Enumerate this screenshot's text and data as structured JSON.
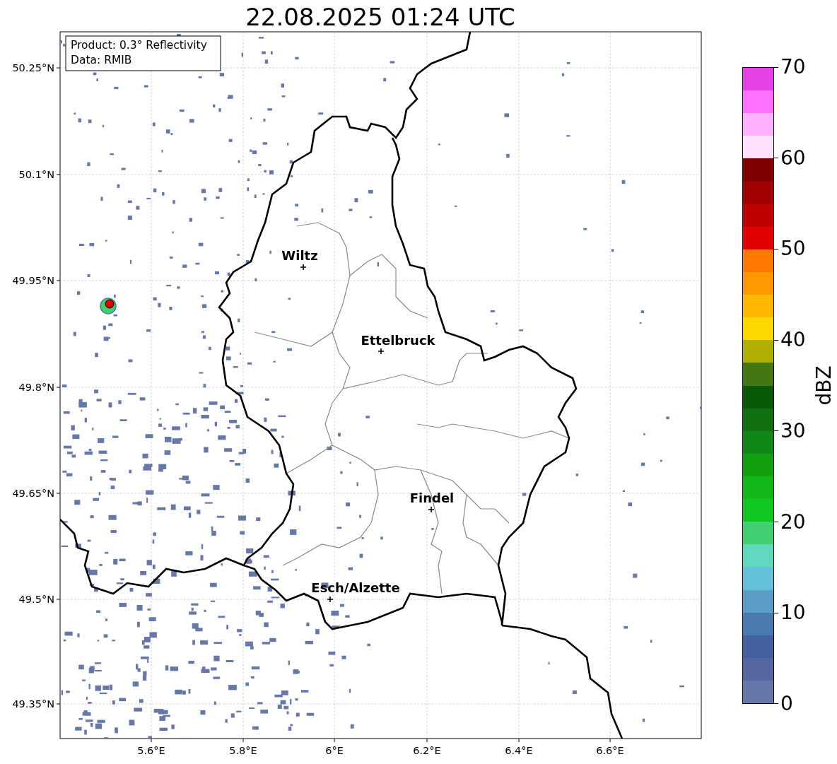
{
  "title": "22.08.2025 01:24 UTC",
  "info_box": [
    "Product: 0.3° Reflectivity",
    "Data: RMIB"
  ],
  "y_axis": {
    "ticks": [
      "50.25°N",
      "50.1°N",
      "49.95°N",
      "49.8°N",
      "49.65°N",
      "49.5°N",
      "49.35°N"
    ]
  },
  "x_axis": {
    "ticks": [
      "5.6°E",
      "5.8°E",
      "6°E",
      "6.2°E",
      "6.4°E",
      "6.6°E"
    ]
  },
  "places": [
    {
      "name": "Wiltz"
    },
    {
      "name": "Ettelbruck"
    },
    {
      "name": "Findel"
    },
    {
      "name": "Esch/Alzette"
    }
  ],
  "colorbar": {
    "label": "dBZ",
    "ticks": [
      "70",
      "60",
      "50",
      "40",
      "30",
      "20",
      "10",
      "0"
    ],
    "bands": [
      {
        "color": "#e840e8"
      },
      {
        "color": "#ff70ff"
      },
      {
        "color": "#ffb0ff"
      },
      {
        "color": "#ffe0ff"
      },
      {
        "color": "#800000"
      },
      {
        "color": "#a00000"
      },
      {
        "color": "#c00000"
      },
      {
        "color": "#e00000"
      },
      {
        "color": "#ff7800"
      },
      {
        "color": "#ff9800"
      },
      {
        "color": "#ffb800"
      },
      {
        "color": "#ffd800"
      },
      {
        "color": "#b0b000"
      },
      {
        "color": "#447810"
      },
      {
        "color": "#085808"
      },
      {
        "color": "#107010"
      },
      {
        "color": "#108818"
      },
      {
        "color": "#10a010"
      },
      {
        "color": "#10b818"
      },
      {
        "color": "#10c820"
      },
      {
        "color": "#40d070"
      },
      {
        "color": "#60d8c0"
      },
      {
        "color": "#64c0d8"
      },
      {
        "color": "#5a9ec8"
      },
      {
        "color": "#4a7ab0"
      },
      {
        "color": "#4460a0"
      },
      {
        "color": "#5566a0"
      },
      {
        "color": "#6677a8"
      }
    ]
  }
}
